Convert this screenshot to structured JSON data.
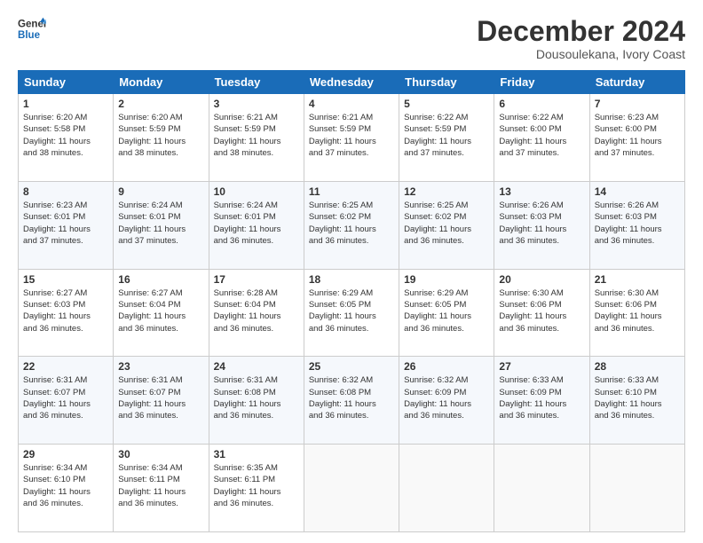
{
  "logo": {
    "line1": "General",
    "line2": "Blue"
  },
  "title": "December 2024",
  "subtitle": "Dousoulekana, Ivory Coast",
  "days_of_week": [
    "Sunday",
    "Monday",
    "Tuesday",
    "Wednesday",
    "Thursday",
    "Friday",
    "Saturday"
  ],
  "weeks": [
    [
      {
        "day": 1,
        "rise": "6:20 AM",
        "set": "5:58 PM",
        "hours": "11 hours",
        "mins": "38"
      },
      {
        "day": 2,
        "rise": "6:20 AM",
        "set": "5:59 PM",
        "hours": "11 hours",
        "mins": "38"
      },
      {
        "day": 3,
        "rise": "6:21 AM",
        "set": "5:59 PM",
        "hours": "11 hours",
        "mins": "38"
      },
      {
        "day": 4,
        "rise": "6:21 AM",
        "set": "5:59 PM",
        "hours": "11 hours",
        "mins": "37"
      },
      {
        "day": 5,
        "rise": "6:22 AM",
        "set": "5:59 PM",
        "hours": "11 hours",
        "mins": "37"
      },
      {
        "day": 6,
        "rise": "6:22 AM",
        "set": "6:00 PM",
        "hours": "11 hours",
        "mins": "37"
      },
      {
        "day": 7,
        "rise": "6:23 AM",
        "set": "6:00 PM",
        "hours": "11 hours",
        "mins": "37"
      }
    ],
    [
      {
        "day": 8,
        "rise": "6:23 AM",
        "set": "6:01 PM",
        "hours": "11 hours",
        "mins": "37"
      },
      {
        "day": 9,
        "rise": "6:24 AM",
        "set": "6:01 PM",
        "hours": "11 hours",
        "mins": "37"
      },
      {
        "day": 10,
        "rise": "6:24 AM",
        "set": "6:01 PM",
        "hours": "11 hours",
        "mins": "36"
      },
      {
        "day": 11,
        "rise": "6:25 AM",
        "set": "6:02 PM",
        "hours": "11 hours",
        "mins": "36"
      },
      {
        "day": 12,
        "rise": "6:25 AM",
        "set": "6:02 PM",
        "hours": "11 hours",
        "mins": "36"
      },
      {
        "day": 13,
        "rise": "6:26 AM",
        "set": "6:03 PM",
        "hours": "11 hours",
        "mins": "36"
      },
      {
        "day": 14,
        "rise": "6:26 AM",
        "set": "6:03 PM",
        "hours": "11 hours",
        "mins": "36"
      }
    ],
    [
      {
        "day": 15,
        "rise": "6:27 AM",
        "set": "6:03 PM",
        "hours": "11 hours",
        "mins": "36"
      },
      {
        "day": 16,
        "rise": "6:27 AM",
        "set": "6:04 PM",
        "hours": "11 hours",
        "mins": "36"
      },
      {
        "day": 17,
        "rise": "6:28 AM",
        "set": "6:04 PM",
        "hours": "11 hours",
        "mins": "36"
      },
      {
        "day": 18,
        "rise": "6:29 AM",
        "set": "6:05 PM",
        "hours": "11 hours",
        "mins": "36"
      },
      {
        "day": 19,
        "rise": "6:29 AM",
        "set": "6:05 PM",
        "hours": "11 hours",
        "mins": "36"
      },
      {
        "day": 20,
        "rise": "6:30 AM",
        "set": "6:06 PM",
        "hours": "11 hours",
        "mins": "36"
      },
      {
        "day": 21,
        "rise": "6:30 AM",
        "set": "6:06 PM",
        "hours": "11 hours",
        "mins": "36"
      }
    ],
    [
      {
        "day": 22,
        "rise": "6:31 AM",
        "set": "6:07 PM",
        "hours": "11 hours",
        "mins": "36"
      },
      {
        "day": 23,
        "rise": "6:31 AM",
        "set": "6:07 PM",
        "hours": "11 hours",
        "mins": "36"
      },
      {
        "day": 24,
        "rise": "6:31 AM",
        "set": "6:08 PM",
        "hours": "11 hours",
        "mins": "36"
      },
      {
        "day": 25,
        "rise": "6:32 AM",
        "set": "6:08 PM",
        "hours": "11 hours",
        "mins": "36"
      },
      {
        "day": 26,
        "rise": "6:32 AM",
        "set": "6:09 PM",
        "hours": "11 hours",
        "mins": "36"
      },
      {
        "day": 27,
        "rise": "6:33 AM",
        "set": "6:09 PM",
        "hours": "11 hours",
        "mins": "36"
      },
      {
        "day": 28,
        "rise": "6:33 AM",
        "set": "6:10 PM",
        "hours": "11 hours",
        "mins": "36"
      }
    ],
    [
      {
        "day": 29,
        "rise": "6:34 AM",
        "set": "6:10 PM",
        "hours": "11 hours",
        "mins": "36"
      },
      {
        "day": 30,
        "rise": "6:34 AM",
        "set": "6:11 PM",
        "hours": "11 hours",
        "mins": "36"
      },
      {
        "day": 31,
        "rise": "6:35 AM",
        "set": "6:11 PM",
        "hours": "11 hours",
        "mins": "36"
      },
      null,
      null,
      null,
      null
    ]
  ],
  "labels": {
    "sunrise": "Sunrise:",
    "sunset": "Sunset:",
    "daylight": "Daylight:",
    "minutes_suffix": "minutes."
  }
}
